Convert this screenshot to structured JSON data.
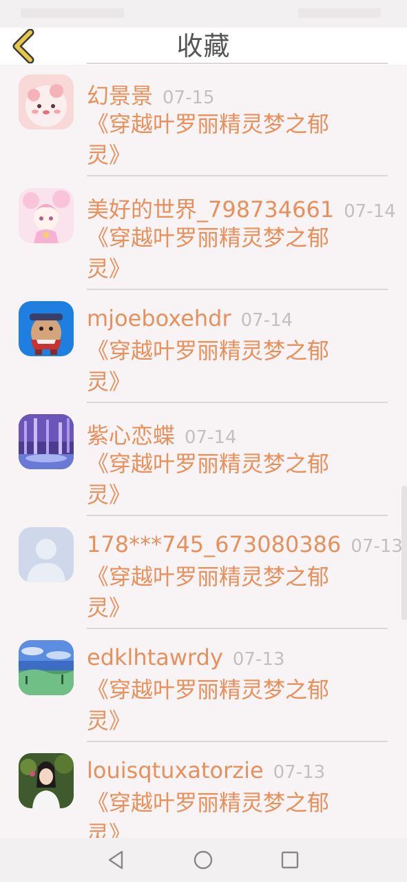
{
  "header": {
    "title": "收藏",
    "back_icon": "chevron-left-icon",
    "back_color": "#e7c64a"
  },
  "colors": {
    "accent": "#e8905b",
    "date": "#c3bec0",
    "divider": "#dcd6d9",
    "background": "#f8f4f6"
  },
  "items": [
    {
      "username": "幻景景",
      "date": "07-15",
      "title": "《穿越叶罗丽精灵梦之郁灵》"
    },
    {
      "username": "美好的世界_798734661",
      "date": "07-14",
      "title": "《穿越叶罗丽精灵梦之郁灵》"
    },
    {
      "username": "mjoeboxehdr",
      "date": "07-14",
      "title": "《穿越叶罗丽精灵梦之郁灵》"
    },
    {
      "username": "紫心恋蝶",
      "date": "07-14",
      "title": "《穿越叶罗丽精灵梦之郁灵》"
    },
    {
      "username": "178***745_673080386",
      "date": "07-13",
      "title": "《穿越叶罗丽精灵梦之郁灵》"
    },
    {
      "username": "edklhtawrdy",
      "date": "07-13",
      "title": "《穿越叶罗丽精灵梦之郁灵》"
    },
    {
      "username": "louisqtuxatorzie",
      "date": "07-13",
      "title": "《穿越叶罗丽精灵梦之郁灵》"
    }
  ],
  "nav": {
    "back_icon": "triangle-back-icon",
    "home_icon": "circle-home-icon",
    "recents_icon": "square-recents-icon"
  }
}
